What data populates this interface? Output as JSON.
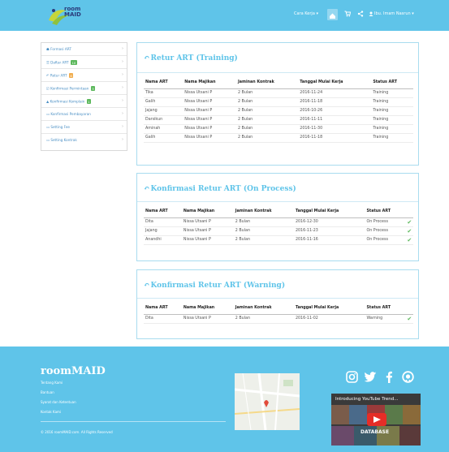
{
  "brand": {
    "line1": "room",
    "line2": "MAID"
  },
  "nav": {
    "cara_kerja": "Cara Kerja ▾",
    "user": "Ibu. Imam Nasrun ▾"
  },
  "sidebar": {
    "items": [
      {
        "label": "Formasi ART",
        "badge": "",
        "icon": "user-icon"
      },
      {
        "label": "Daftar ART",
        "badge": "10",
        "icon": "list-icon"
      },
      {
        "label": "Retur ART",
        "badge": "6",
        "icon": "return-icon"
      },
      {
        "label": "Konfirmasi Permintaan",
        "badge": "3",
        "icon": "check-icon"
      },
      {
        "label": "Konfirmasi Komplain",
        "badge": "1",
        "icon": "warning-icon"
      },
      {
        "label": "Konfirmasi Pembayaran",
        "badge": "",
        "icon": "card-icon"
      },
      {
        "label": "Setting Fee",
        "badge": "",
        "icon": "card-icon"
      },
      {
        "label": "Setting Kontrak",
        "badge": "",
        "icon": "card-icon"
      }
    ]
  },
  "panels": {
    "training": {
      "title": "Retur ART (Training)",
      "headers": [
        "Nama ART",
        "Nama Majikan",
        "Jaminan Kontrak",
        "Tanggal Mulai Kerja",
        "Status ART"
      ],
      "rows": [
        [
          "Tika",
          "Nissa Utsani P",
          "2 Bulan",
          "2016-11-24",
          "Training"
        ],
        [
          "Galih",
          "Nissa Utsani P",
          "2 Bulan",
          "2016-11-18",
          "Training"
        ],
        [
          "Jajang",
          "Nissa Utsani P",
          "2 Bulan",
          "2016-10-26",
          "Training"
        ],
        [
          "Darsikun",
          "Nissa Utsani P",
          "2 Bulan",
          "2016-11-11",
          "Training"
        ],
        [
          "Aminah",
          "Nissa Utsani P",
          "2 Bulan",
          "2016-11-30",
          "Training"
        ],
        [
          "Galih",
          "Nissa Utsani P",
          "2 Bulan",
          "2016-11-18",
          "Training"
        ]
      ]
    },
    "process": {
      "title": "Konfirmasi Retur ART (On Process)",
      "headers": [
        "Nama ART",
        "Nama Majikan",
        "Jaminan Kontrak",
        "Tanggal Mulai Kerja",
        "Status ART"
      ],
      "rows": [
        [
          "Dita",
          "Nissa Utsani P",
          "2 Bulan",
          "2016-12-30",
          "On Process"
        ],
        [
          "Jajang",
          "Nissa Utsani P",
          "2 Bulan",
          "2016-11-23",
          "On Process"
        ],
        [
          "Anandhi",
          "Nissa Utsani P",
          "2 Bulan",
          "2016-11-16",
          "On Process"
        ]
      ]
    },
    "warning": {
      "title": "Konfirmasi Retur ART (Warning)",
      "headers": [
        "Nama ART",
        "Nama Majikan",
        "Jaminan Kontrak",
        "Tanggal Mulai Kerja",
        "Status ART"
      ],
      "rows": [
        [
          "Dita",
          "Nissa Utsani P",
          "2 Bulan",
          "2016-11-02",
          "Warning"
        ]
      ]
    }
  },
  "footer": {
    "title": "roomMAID",
    "links": [
      "Tentang Kami",
      "Bantuan",
      "Syarat dan Ketentuan",
      "Kontak Kami"
    ],
    "copyright": "© 2016 roomMAID.com. All Rights Reserved",
    "video_title": "Introducing YouTube Trend...",
    "video_overlay": "DATABASE"
  },
  "colors": {
    "primary": "#5fc4e9",
    "badge_green": "#5cb85c",
    "badge_orange": "#f0ad4e",
    "check_green": "#5cb85c"
  }
}
